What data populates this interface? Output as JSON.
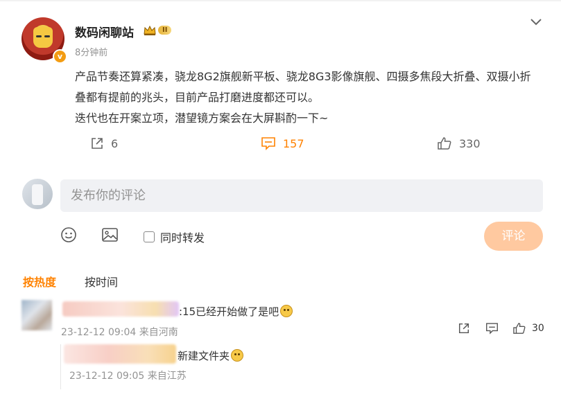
{
  "post": {
    "username": "数码闲聊站",
    "level": "II",
    "time": "8分钟前",
    "verified_mark": "v",
    "content_lines": [
      "产品节奏还算紧凑，骁龙8G2旗舰新平板、骁龙8G3影像旗舰、四摄多焦段大折叠、双摄小折叠都有提前的兆头，目前产品打磨进度都还可以。",
      "迭代也在开案立项，潜望镜方案会在大屏斟酌一下~"
    ],
    "reposts": "6",
    "comments": "157",
    "likes": "330"
  },
  "composer": {
    "placeholder": "发布你的评论",
    "repost_label": "同时转发",
    "submit_label": "评论"
  },
  "sort": {
    "hot": "按热度",
    "time": "按时间"
  },
  "comments": [
    {
      "text": ":15已经开始做了是吧",
      "meta": "23-12-12 09:04 来自河南",
      "likes": "30",
      "reply": {
        "text": "新建文件夹",
        "meta": "23-12-12 09:05 来自江苏"
      }
    }
  ],
  "colors": {
    "accent": "#ff8200",
    "submit_bg": "#ffc9a0",
    "muted": "#939393"
  }
}
